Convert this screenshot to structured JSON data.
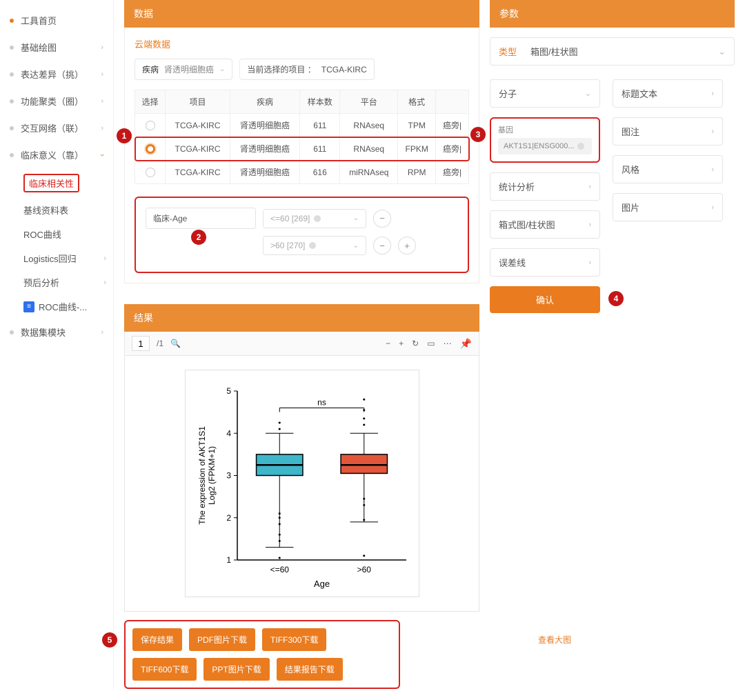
{
  "sidebar": {
    "items": [
      {
        "label": "工具首页",
        "current": true
      },
      {
        "label": "基础绘图",
        "expand": true
      },
      {
        "label": "表达差异（挑）",
        "expand": true
      },
      {
        "label": "功能聚类（圈）",
        "expand": true
      },
      {
        "label": "交互网络（联）",
        "expand": true
      },
      {
        "label": "临床意义（靠）",
        "expand": true,
        "open": true
      },
      {
        "label": "数据集模块",
        "expand": true
      }
    ],
    "sub": [
      {
        "label": "临床相关性",
        "selected": true
      },
      {
        "label": "基线资料表"
      },
      {
        "label": "ROC曲线"
      },
      {
        "label": "Logistics回归",
        "chev": true
      },
      {
        "label": "预后分析",
        "chev": true
      },
      {
        "label": "ROC曲线-...",
        "badge": true
      }
    ]
  },
  "dataPanel": {
    "title": "数据",
    "cloud": "云端数据",
    "diseaseLabel": "疾病",
    "diseaseValue": "肾透明细胞癌",
    "currentLabel": "当前选择的项目 ：",
    "currentValue": "TCGA-KIRC",
    "cols": [
      "选择",
      "项目",
      "疾病",
      "样本数",
      "平台",
      "格式",
      ""
    ],
    "rows": [
      {
        "sel": false,
        "proj": "TCGA-KIRC",
        "dis": "肾透明细胞癌",
        "n": "611",
        "plat": "RNAseq",
        "fmt": "TPM",
        "tail": "癌旁|"
      },
      {
        "sel": true,
        "proj": "TCGA-KIRC",
        "dis": "肾透明细胞癌",
        "n": "611",
        "plat": "RNAseq",
        "fmt": "FPKM",
        "tail": "癌旁|"
      },
      {
        "sel": false,
        "proj": "TCGA-KIRC",
        "dis": "肾透明细胞癌",
        "n": "616",
        "plat": "miRNAseq",
        "fmt": "RPM",
        "tail": "癌旁|"
      }
    ],
    "clinField": "临床-Age",
    "clinOpt1": "<=60 [269]",
    "clinOpt2": ">60 [270]"
  },
  "results": {
    "title": "结果",
    "page": "1",
    "pageTotal": "/1",
    "buttons": [
      "保存结果",
      "PDF图片下载",
      "TIFF300下载",
      "TIFF600下载",
      "PPT图片下载",
      "结果报告下载"
    ],
    "viewBig": "查看大图"
  },
  "params": {
    "title": "参数",
    "typeLabel": "类型",
    "typeValue": "箱图/柱状图",
    "leftCards": [
      "分子",
      "统计分析",
      "箱式图/柱状图",
      "误差线"
    ],
    "rightCards": [
      "标题文本",
      "图注",
      "风格",
      "图片"
    ],
    "geneLabel": "基因",
    "geneValue": "AKT1S1|ENSG000...",
    "confirm": "确认"
  },
  "annotations": {
    "a1": "1",
    "a2": "2",
    "a3": "3",
    "a4": "4",
    "a5": "5"
  },
  "chart_data": {
    "type": "box",
    "title": "",
    "xlabel": "Age",
    "ylabel": "The expression of AKT1S1\nLog2 (FPKM+1)",
    "ylim": [
      1,
      5
    ],
    "yticks": [
      1,
      2,
      3,
      4,
      5
    ],
    "categories": [
      "<=60",
      ">60"
    ],
    "annotation": "ns",
    "series": [
      {
        "name": "<=60",
        "color": "#3fb6c9",
        "min": 1.3,
        "q1": 3.0,
        "median": 3.25,
        "q3": 3.5,
        "max": 4.0,
        "outliers": [
          1.05,
          1.45,
          1.6,
          1.85,
          2.0,
          2.1,
          4.1,
          4.25
        ]
      },
      {
        "name": ">60",
        "color": "#e2573b",
        "min": 1.9,
        "q1": 3.05,
        "median": 3.25,
        "q3": 3.5,
        "max": 4.0,
        "outliers": [
          1.1,
          1.95,
          2.3,
          2.45,
          4.2,
          4.35,
          4.55,
          4.8
        ]
      }
    ]
  }
}
